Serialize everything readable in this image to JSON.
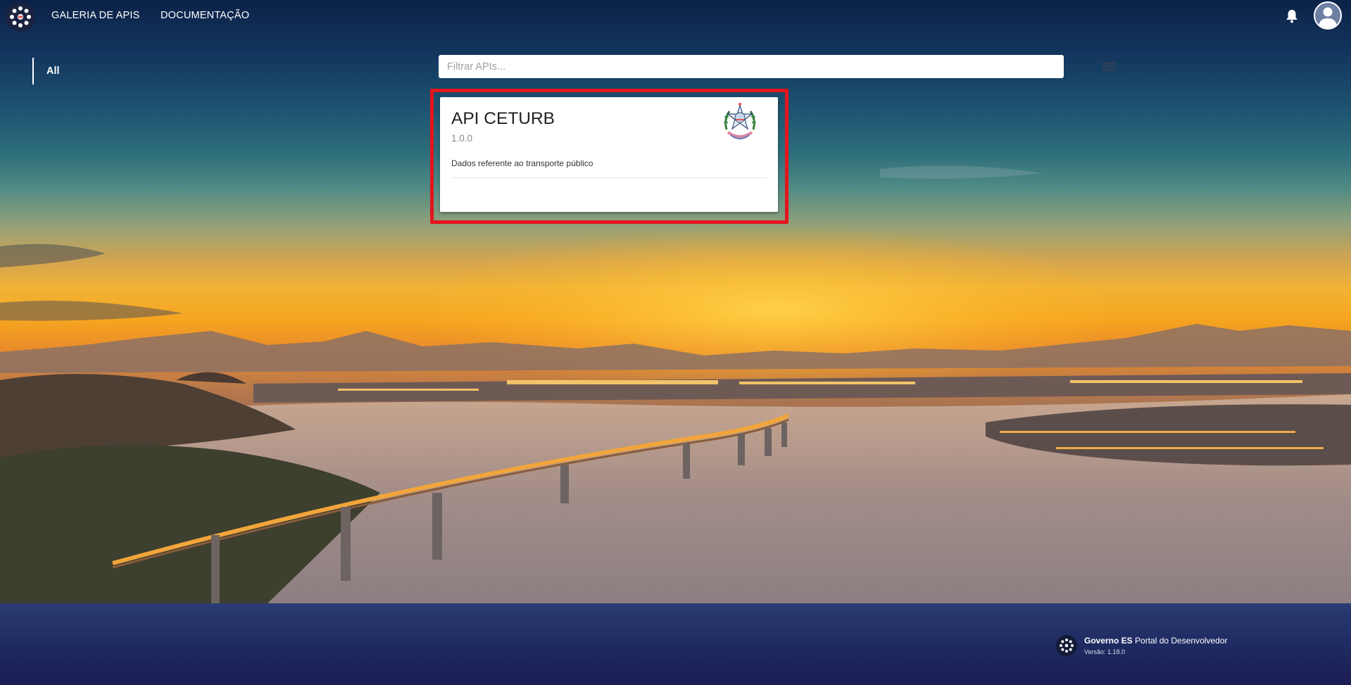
{
  "nav": {
    "links": [
      "GALERIA DE APIS",
      "DOCUMENTAÇÃO"
    ]
  },
  "sidebar": {
    "items": [
      {
        "label": "All",
        "active": true
      }
    ]
  },
  "search": {
    "placeholder": "Filtrar APIs...",
    "value": ""
  },
  "apis": [
    {
      "title": "API CETURB",
      "version": "1.0.0",
      "description": "Dados referente ao transporte público",
      "logo_icon": "state-coat-of-arms-icon"
    }
  ],
  "footer": {
    "org": "Governo ES",
    "portal": "Portal do Desenvolvedor",
    "version": "Versão: 1.18.0"
  },
  "colors": {
    "highlight": "#e3151d",
    "footer": "#1f2b62",
    "card": "#ffffff"
  }
}
